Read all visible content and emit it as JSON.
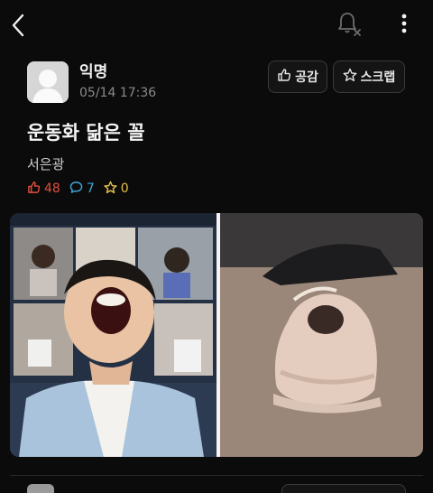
{
  "header": {
    "back_icon": "chevron-left-icon",
    "notification_icon": "bell-off-icon",
    "more_icon": "more-vertical-icon"
  },
  "post": {
    "author": "익명",
    "date": "05/14 17:36",
    "title": "운동화 닮은 꼴",
    "body": "서은광",
    "stats": {
      "likes": "48",
      "comments": "7",
      "scraps": "0"
    },
    "image_icon": "post-photo"
  },
  "actions": {
    "like_label": "공감",
    "scrap_label": "스크랩"
  },
  "colors": {
    "background": "#0b0b0b",
    "like": "#e2503b",
    "comment": "#3fa8d8",
    "scrap": "#e6c24a"
  }
}
